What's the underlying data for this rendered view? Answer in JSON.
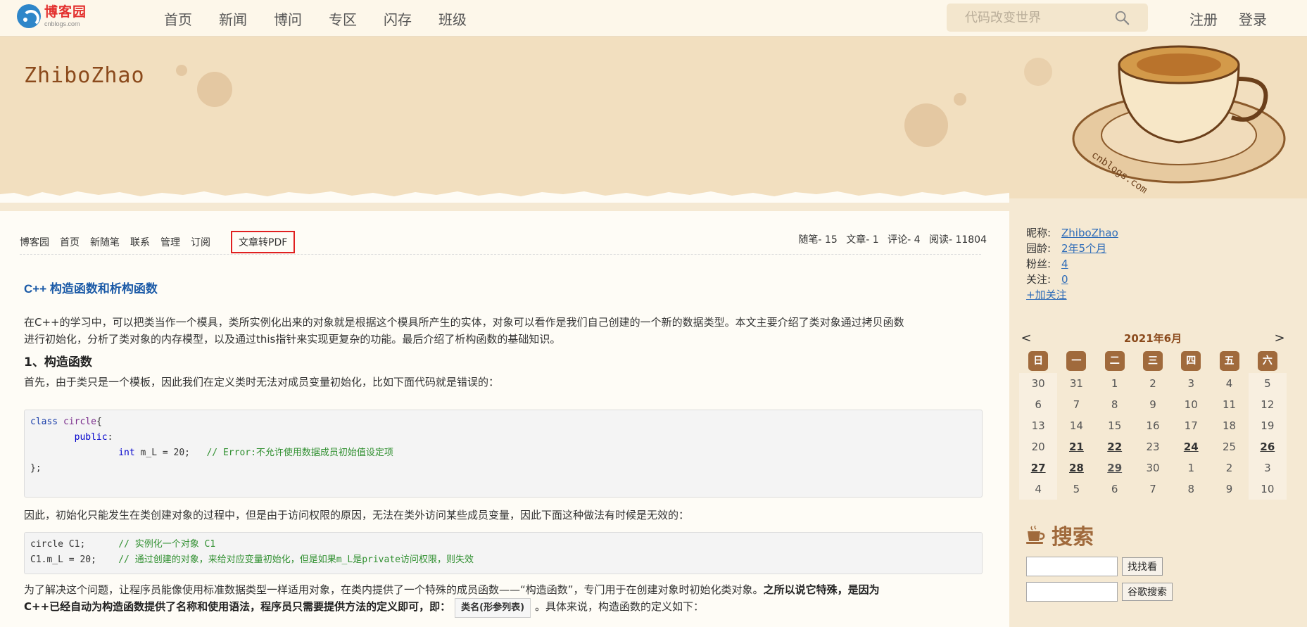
{
  "topnav": {
    "logo_cn": "博客园",
    "logo_en": "cnblogs.com",
    "items": [
      "首页",
      "新闻",
      "博问",
      "专区",
      "闪存",
      "班级"
    ],
    "search_placeholder": "代码改变世界",
    "register": "注册",
    "login": "登录"
  },
  "blog": {
    "title": "ZhiboZhao"
  },
  "subnav": {
    "items": [
      "博客园",
      "首页",
      "新随笔",
      "联系",
      "管理",
      "订阅"
    ],
    "pdf": "文章转PDF",
    "stats": [
      "随笔- 15",
      "文章- 1",
      "评论- 4",
      "阅读- 11804"
    ]
  },
  "post": {
    "title": "C++ 构造函数和析构函数",
    "intro_line1": "在C++的学习中，可以把类当作一个模具，类所实例化出来的对象就是根据这个模具所产生的实体，对象可以看作是我们自己创建的一个新的数据类型。本文主要介绍了类对象通过拷贝函数",
    "intro_line2": "进行初始化，分析了类对象的内存模型，以及通过this指针来实现更复杂的功能。最后介绍了析构函数的基础知识。",
    "section1": "1、构造函数",
    "p1": "首先，由于类只是一个模板，因此我们在定义类时无法对成员变量初始化，比如下面代码就是错误的：",
    "code1": {
      "l1_kw": "class",
      "l1_name": " circle",
      "l1_rest": "{",
      "l2_kw": "public",
      "l2_rest": ":",
      "l3_kw": "int",
      "l3_rest": " m_L = 20;",
      "l3_cm": "// Error:不允许使用数据成员初始值设定项",
      "l4": "};"
    },
    "p2": "因此，初始化只能发生在类创建对象的过程中，但是由于访问权限的原因，无法在类外访问某些成员变量，因此下面这种做法有时候是无效的：",
    "code2": {
      "l1_code": "circle C1;",
      "l1_cm": "// 实例化一个对象 C1",
      "l2_code": "C1.m_L = 20;",
      "l2_cm": "// 通过创建的对象，来给对应变量初始化，但是如果m_L是private访问权限，则失效"
    },
    "p3_a": "为了解决这个问题，让程序员能像使用标准数据类型一样适用对象，在类内提供了一个特殊的成员函数——“构造函数”，专门用于在创建对象时初始化类对象。",
    "p3_b": "之所以说它特殊，是因为",
    "p3_c": "C++已经自动为构造函数提供了名称和使用语法，程序员只需要提供方法的定义即可，即：",
    "p3_box": "类名(形参列表)",
    "p3_d": "。具体来说，构造函数的定义如下："
  },
  "sidebar": {
    "profile": [
      {
        "k": "昵称:",
        "v": "ZhiboZhao"
      },
      {
        "k": "园龄:",
        "v": "2年5个月"
      },
      {
        "k": "粉丝:",
        "v": "4"
      },
      {
        "k": "关注:",
        "v": "0"
      }
    ],
    "follow": "+加关注",
    "calendar": {
      "prev": "<",
      "next": ">",
      "title": "2021年6月",
      "weekdays": [
        "日",
        "一",
        "二",
        "三",
        "四",
        "五",
        "六"
      ],
      "weeks": [
        [
          "30",
          "31",
          "1",
          "2",
          "3",
          "4",
          "5"
        ],
        [
          "6",
          "7",
          "8",
          "9",
          "10",
          "11",
          "12"
        ],
        [
          "13",
          "14",
          "15",
          "16",
          "17",
          "18",
          "19"
        ],
        [
          "20",
          "21",
          "22",
          "23",
          "24",
          "25",
          "26"
        ],
        [
          "27",
          "28",
          "29",
          "30",
          "1",
          "2",
          "3"
        ],
        [
          "4",
          "5",
          "6",
          "7",
          "8",
          "9",
          "10"
        ]
      ]
    },
    "search_title": "搜索",
    "search_btn1": "找找看",
    "search_btn2": "谷歌搜索"
  },
  "colors": {
    "accent_brown": "#a06a3c",
    "link_blue": "#2e6cb8",
    "title_blue": "#1b5aa7",
    "pdf_border": "#e02020"
  }
}
